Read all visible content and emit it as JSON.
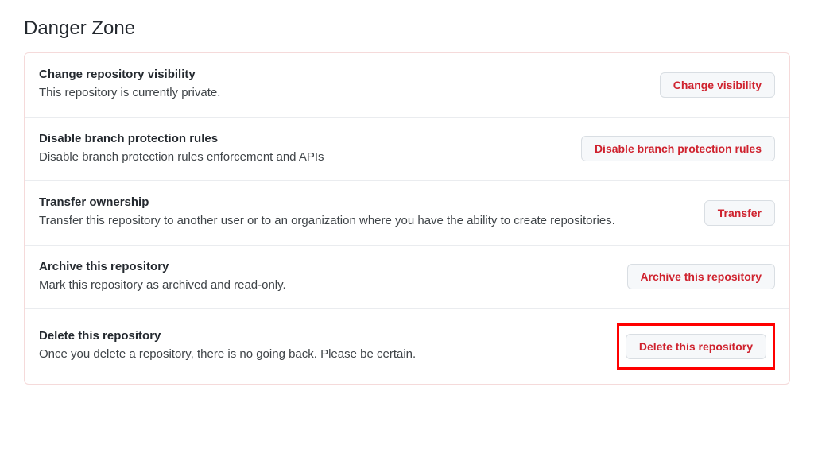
{
  "section": {
    "title": "Danger Zone"
  },
  "items": [
    {
      "title": "Change repository visibility",
      "description": "This repository is currently private.",
      "button": "Change visibility"
    },
    {
      "title": "Disable branch protection rules",
      "description": "Disable branch protection rules enforcement and APIs",
      "button": "Disable branch protection rules"
    },
    {
      "title": "Transfer ownership",
      "description": "Transfer this repository to another user or to an organization where you have the ability to create repositories.",
      "button": "Transfer"
    },
    {
      "title": "Archive this repository",
      "description": "Mark this repository as archived and read-only.",
      "button": "Archive this repository"
    },
    {
      "title": "Delete this repository",
      "description": "Once you delete a repository, there is no going back. Please be certain.",
      "button": "Delete this repository"
    }
  ]
}
